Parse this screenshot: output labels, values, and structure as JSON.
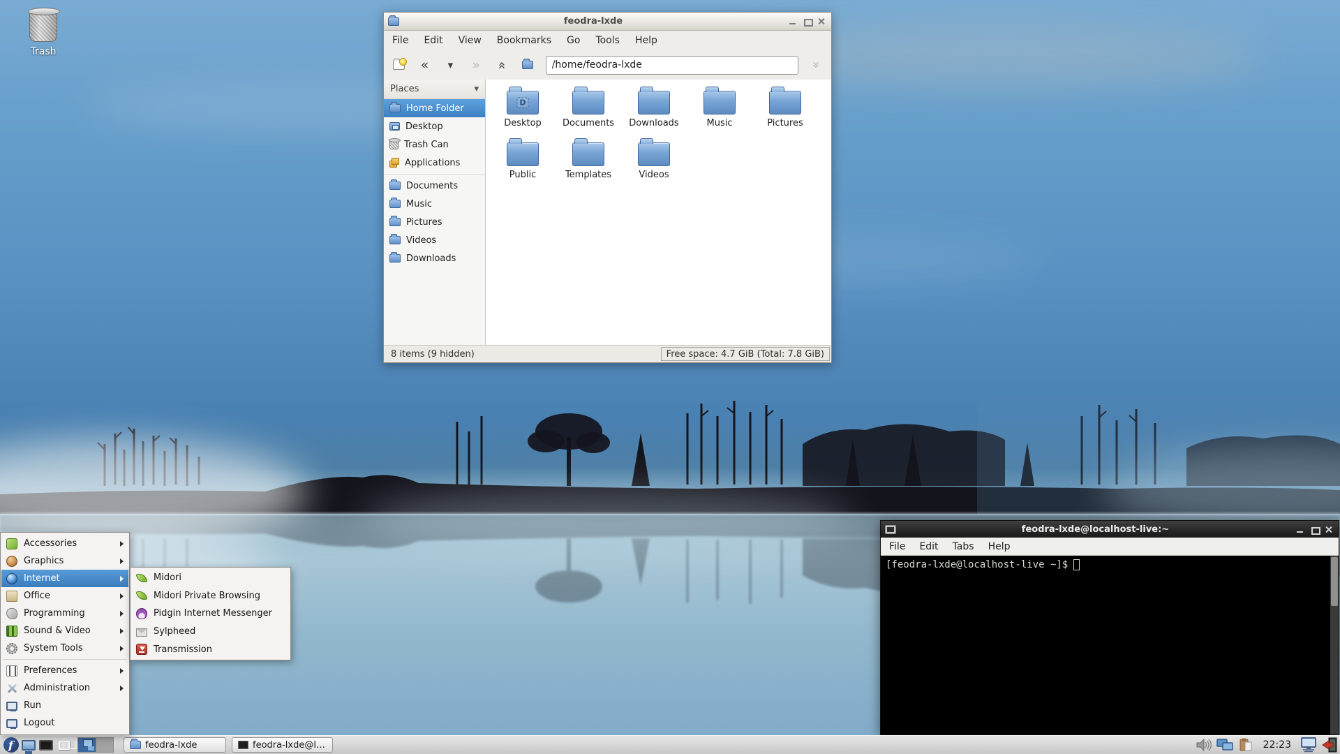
{
  "desktop": {
    "trash_label": "Trash"
  },
  "glyphs": {
    "back": "«",
    "forward": "»",
    "history": "▾",
    "up": "»",
    "jump": "»",
    "places_chevron": "▾"
  },
  "colors": {
    "selection_blue": "#4a90d2",
    "fedora_blue": "#294172",
    "terminal_bg": "#000000",
    "terminal_fg": "#d3d7cf",
    "window_bg": "#efedea"
  },
  "file_manager": {
    "title": "feodra-lxde",
    "menu": [
      "File",
      "Edit",
      "View",
      "Bookmarks",
      "Go",
      "Tools",
      "Help"
    ],
    "address": "/home/feodra-lxde",
    "places_header": "Places",
    "places": [
      {
        "label": "Home Folder",
        "icon": "home-folder-icon",
        "selected": true
      },
      {
        "label": "Desktop",
        "icon": "desktop-folder-icon",
        "selected": false
      },
      {
        "label": "Trash Can",
        "icon": "trash-icon",
        "selected": false
      },
      {
        "label": "Applications",
        "icon": "applications-icon",
        "selected": false
      },
      {
        "label": "Documents",
        "icon": "folder-icon",
        "selected": false
      },
      {
        "label": "Music",
        "icon": "folder-icon",
        "selected": false
      },
      {
        "label": "Pictures",
        "icon": "folder-icon",
        "selected": false
      },
      {
        "label": "Videos",
        "icon": "folder-icon",
        "selected": false
      },
      {
        "label": "Downloads",
        "icon": "folder-icon",
        "selected": false
      }
    ],
    "folders": [
      "Desktop",
      "Documents",
      "Downloads",
      "Music",
      "Pictures",
      "Public",
      "Templates",
      "Videos"
    ],
    "desktop_emblem": "D",
    "status_left": "8 items (9 hidden)",
    "status_right": "Free space: 4.7 GiB (Total: 7.8 GiB)"
  },
  "terminal": {
    "title": "feodra-lxde@localhost-live:~",
    "menu": [
      "File",
      "Edit",
      "Tabs",
      "Help"
    ],
    "prompt": "[feodra-lxde@localhost-live ~]$"
  },
  "start_menu": {
    "items": [
      {
        "label": "Accessories",
        "icon": "accessories-icon",
        "has_submenu": true,
        "selected": false
      },
      {
        "label": "Graphics",
        "icon": "graphics-icon",
        "has_submenu": true,
        "selected": false
      },
      {
        "label": "Internet",
        "icon": "internet-globe-icon",
        "has_submenu": true,
        "selected": true
      },
      {
        "label": "Office",
        "icon": "office-icon",
        "has_submenu": true,
        "selected": false
      },
      {
        "label": "Programming",
        "icon": "programming-icon",
        "has_submenu": true,
        "selected": false
      },
      {
        "label": "Sound & Video",
        "icon": "sound-video-icon",
        "has_submenu": true,
        "selected": false
      },
      {
        "label": "System Tools",
        "icon": "system-tools-icon",
        "has_submenu": true,
        "selected": false
      },
      {
        "label": "Preferences",
        "icon": "preferences-icon",
        "has_submenu": true,
        "selected": false
      },
      {
        "label": "Administration",
        "icon": "administration-icon",
        "has_submenu": true,
        "selected": false
      },
      {
        "label": "Run",
        "icon": "run-icon",
        "has_submenu": false,
        "selected": false
      },
      {
        "label": "Logout",
        "icon": "logout-icon",
        "has_submenu": false,
        "selected": false
      }
    ]
  },
  "submenu": {
    "items": [
      {
        "label": "Midori",
        "icon": "midori-leaf-icon"
      },
      {
        "label": "Midori Private Browsing",
        "icon": "midori-leaf-icon"
      },
      {
        "label": "Pidgin Internet Messenger",
        "icon": "pidgin-icon"
      },
      {
        "label": "Sylpheed",
        "icon": "sylpheed-icon"
      },
      {
        "label": "Transmission",
        "icon": "transmission-icon"
      }
    ]
  },
  "taskbar": {
    "start_glyph": "f",
    "tasks": [
      {
        "label": "feodra-lxde",
        "icon": "folder-icon"
      },
      {
        "label": "feodra-lxde@loc...",
        "icon": "terminal-icon"
      }
    ],
    "clock": "22:23"
  }
}
